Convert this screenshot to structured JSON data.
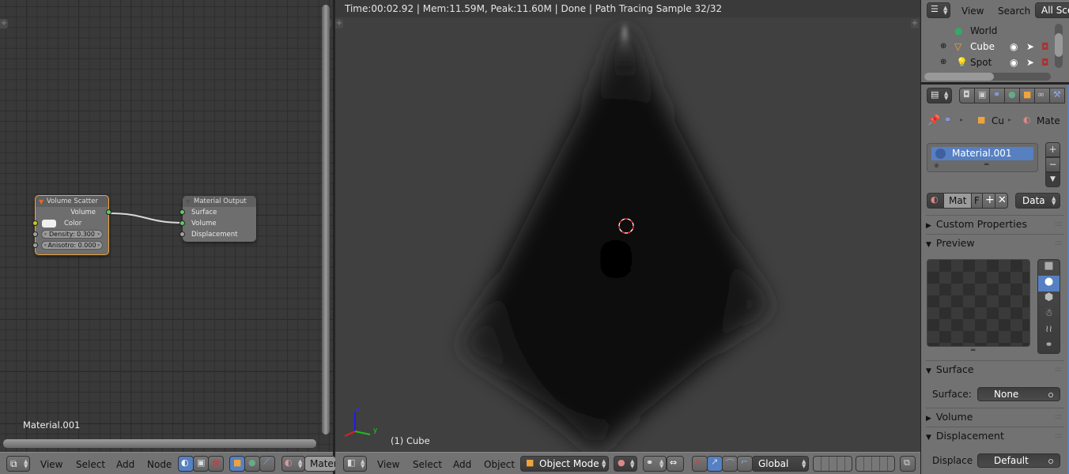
{
  "node_editor": {
    "material_label": "Material.001",
    "nodes": {
      "volume_scatter": {
        "title": "Volume Scatter",
        "output_volume": "Volume",
        "color_label": "Color",
        "density": "Density:  0.300",
        "anisotropy": "Anisotro: 0.000"
      },
      "material_output": {
        "title": "Material Output",
        "inputs": [
          "Surface",
          "Volume",
          "Displacement"
        ]
      }
    },
    "header": {
      "menus": [
        "View",
        "Select",
        "Add",
        "Node"
      ],
      "material_field": "Mater"
    }
  },
  "viewport": {
    "render_info": "Time:00:02.92 | Mem:11.59M, Peak:11.60M | Done | Path Tracing Sample 32/32",
    "object_label": "(1) Cube",
    "axes": {
      "x": "x",
      "y": "y",
      "z": "z"
    },
    "header": {
      "menus": [
        "View",
        "Select",
        "Add",
        "Object"
      ],
      "mode": "Object Mode",
      "orientation": "Global"
    }
  },
  "outliner": {
    "menus": [
      "View",
      "Search"
    ],
    "scene_filter": "All Sce",
    "items": [
      {
        "name": "World",
        "icon": "world-icon"
      },
      {
        "name": "Cube",
        "icon": "mesh-icon"
      },
      {
        "name": "Spot",
        "icon": "lamp-icon"
      }
    ]
  },
  "properties": {
    "breadcrumb": [
      "Cu",
      "Mate"
    ],
    "material_slot": "Material.001",
    "datablock": {
      "name": "Mat",
      "fake_user": "F",
      "link": "Data"
    },
    "panels": {
      "custom_properties": "Custom Properties",
      "preview": "Preview",
      "surface": "Surface",
      "surface_label": "Surface:",
      "surface_value": "None",
      "volume": "Volume",
      "displacement": "Displacement",
      "displace_label": "Displace",
      "displace_value": "Default"
    },
    "colors": {
      "selection": "#5680c2",
      "node_selected_border": "#f0a33c"
    }
  }
}
